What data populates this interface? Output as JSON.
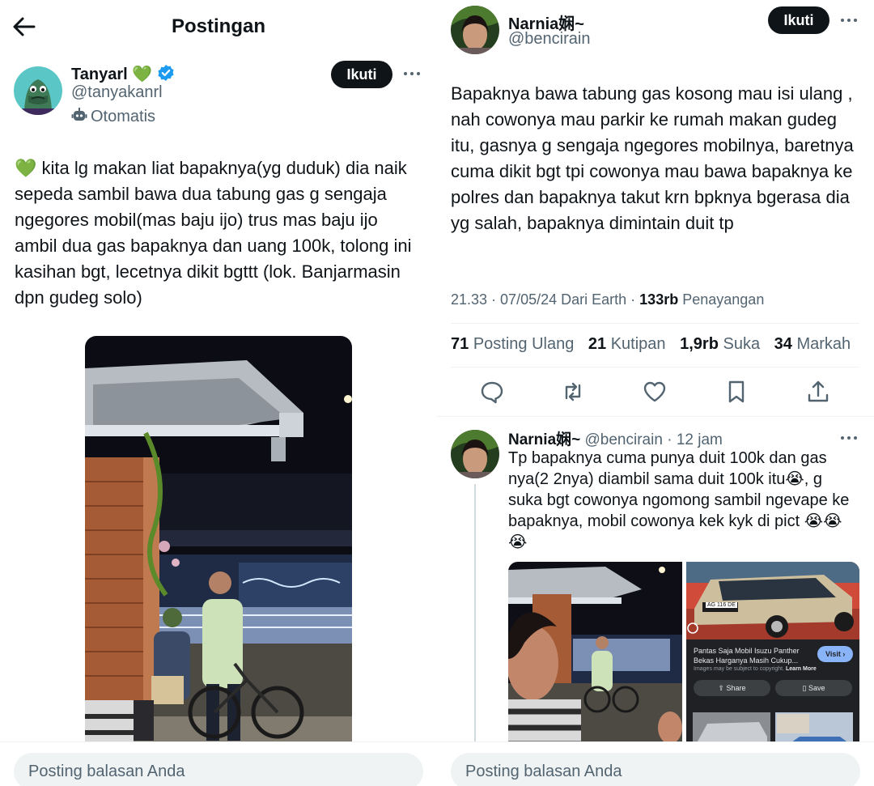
{
  "left": {
    "header": {
      "title": "Postingan"
    },
    "post": {
      "author_name": "Tanyarl",
      "author_badge_emoji": "💚",
      "author_handle": "@tanyakanrl",
      "automated_label": "Otomatis",
      "follow_label": "Ikuti",
      "text": "kita lg makan liat bapaknya(yg duduk) dia naik sepeda sambil bawa dua tabung gas g sengaja ngegores mobil(mas baju ijo) trus mas baju ijo ambil dua gas bapaknya dan uang 100k, tolong ini kasihan bgt, lecetnya dikit bgttt (lok. Banjarmasin dpn gudeg solo)",
      "text_emoji": "💚"
    },
    "reply_placeholder": "Posting balasan Anda"
  },
  "right": {
    "post": {
      "author_name": "Narnia娴~",
      "author_handle": "@bencirain",
      "follow_label": "Ikuti",
      "text": "Bapaknya bawa tabung gas kosong mau isi ulang , nah cowonya mau parkir ke rumah makan gudeg itu, gasnya g sengaja ngegores mobilnya, baretnya cuma dikit bgt tpi cowonya mau bawa bapaknya ke polres dan bapaknya takut krn bpknya bgerasa dia yg salah, bapaknya dimintain duit tp"
    },
    "meta": {
      "time": "21.33",
      "date": "07/05/24",
      "source": "Dari Earth",
      "views": "133rb",
      "views_label": "Penayangan"
    },
    "stats": {
      "reposts": "71",
      "reposts_label": "Posting Ulang",
      "quotes": "21",
      "quotes_label": "Kutipan",
      "likes": "1,9rb",
      "likes_label": "Suka",
      "bookmarks": "34",
      "bookmarks_label": "Markah"
    },
    "actions": [
      "reply-icon",
      "repost-icon",
      "like-icon",
      "bookmark-icon",
      "share-icon"
    ],
    "reply": {
      "author_name": "Narnia娴~",
      "author_handle": "@bencirain",
      "time": "12 jam",
      "text": "Tp bapaknya cuma punya duit 100k dan gas nya(2 2nya) diambil sama duit 100k itu😭, g suka bgt cowonya ngomong sambil ngevape ke bapaknya, mobil cowonya kek kyk di pict 😭😭😭",
      "search_card": {
        "title": "Pantas Saja Mobil Isuzu Panther Bekas Harganya Masih Cukup...",
        "notice": "Images may be subject to copyright.",
        "learn_more": "Learn More",
        "visit_label": "Visit",
        "share_label": "Share",
        "save_label": "Save",
        "plate_text": "AG 116 DE"
      }
    },
    "reply_placeholder": "Posting balasan Anda"
  },
  "colors": {
    "text": "#0f1419",
    "secondary": "#536471",
    "verified": "#1d9bf0",
    "follow_bg": "#0f1419",
    "input_bg": "#eff3f4",
    "google_dark": "#202124",
    "visit_blue": "#8ab4f8"
  }
}
